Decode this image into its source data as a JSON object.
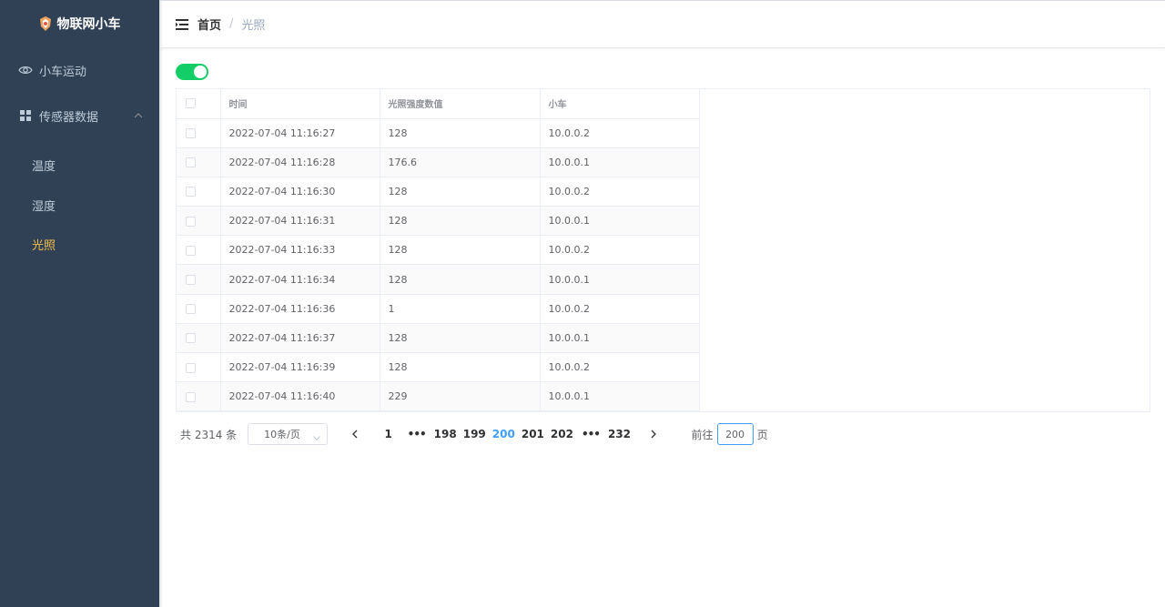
{
  "app": {
    "title": "物联网小车"
  },
  "sidebar": {
    "items": [
      {
        "label": "小车运动",
        "icon": "eye-icon"
      },
      {
        "label": "传感器数据",
        "icon": "grid-icon",
        "expanded": true
      }
    ],
    "subitems": [
      {
        "label": "温度"
      },
      {
        "label": "湿度"
      },
      {
        "label": "光照",
        "active": true
      }
    ]
  },
  "breadcrumb": {
    "home": "首页",
    "separator": "/",
    "current": "光照"
  },
  "toggle": {
    "on": true
  },
  "table": {
    "headers": [
      "时间",
      "光照强度数值",
      "小车"
    ],
    "rows": [
      [
        "2022-07-04 11:16:27",
        "128",
        "10.0.0.2"
      ],
      [
        "2022-07-04 11:16:28",
        "176.6",
        "10.0.0.1"
      ],
      [
        "2022-07-04 11:16:30",
        "128",
        "10.0.0.2"
      ],
      [
        "2022-07-04 11:16:31",
        "128",
        "10.0.0.1"
      ],
      [
        "2022-07-04 11:16:33",
        "128",
        "10.0.0.2"
      ],
      [
        "2022-07-04 11:16:34",
        "128",
        "10.0.0.1"
      ],
      [
        "2022-07-04 11:16:36",
        "1",
        "10.0.0.2"
      ],
      [
        "2022-07-04 11:16:37",
        "128",
        "10.0.0.1"
      ],
      [
        "2022-07-04 11:16:39",
        "128",
        "10.0.0.2"
      ],
      [
        "2022-07-04 11:16:40",
        "229",
        "10.0.0.1"
      ]
    ]
  },
  "pagination": {
    "total_label": "共 2314 条",
    "page_size": "10条/页",
    "pages": [
      "1",
      "...",
      "198",
      "199",
      "200",
      "201",
      "202",
      "...",
      "232"
    ],
    "current": "200",
    "goto_prefix": "前往",
    "goto_value": "200",
    "goto_suffix": "页"
  },
  "colors": {
    "sidebar_bg": "#304156",
    "active_menu": "#f4c04b",
    "toggle_on": "#13ce66",
    "page_active": "#409eff"
  }
}
